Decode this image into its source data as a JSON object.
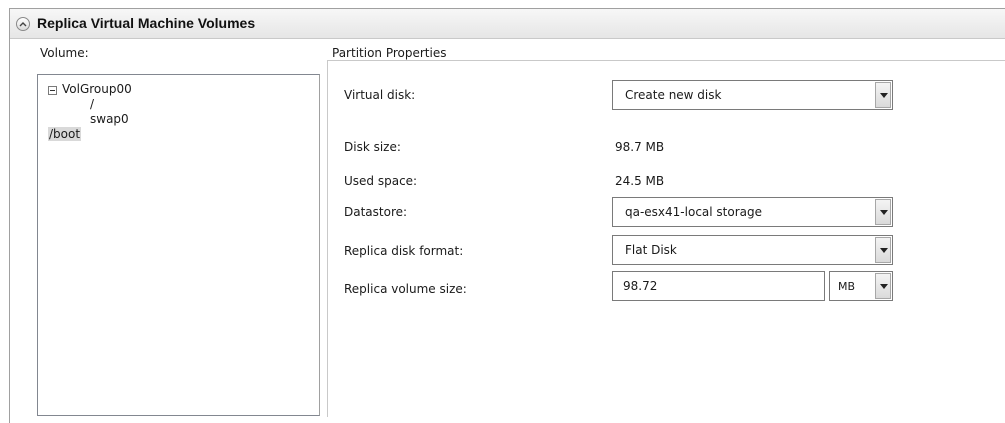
{
  "section": {
    "title": "Replica Virtual Machine Volumes"
  },
  "volume": {
    "label": "Volume:",
    "tree": {
      "group": "VolGroup00",
      "children": [
        "/",
        "swap0"
      ],
      "root_item": "/boot"
    }
  },
  "partition": {
    "legend": "Partition Properties",
    "virtual_disk": {
      "label": "Virtual disk:",
      "value": "Create new disk"
    },
    "disk_size": {
      "label": "Disk size:",
      "value": "98.7 MB"
    },
    "used_space": {
      "label": "Used space:",
      "value": "24.5 MB"
    },
    "datastore": {
      "label": "Datastore:",
      "value": "qa-esx41-local storage"
    },
    "disk_format": {
      "label": "Replica disk format:",
      "value": "Flat Disk"
    },
    "volume_size": {
      "label": "Replica volume size:",
      "value": "98.72",
      "unit": "MB"
    }
  }
}
